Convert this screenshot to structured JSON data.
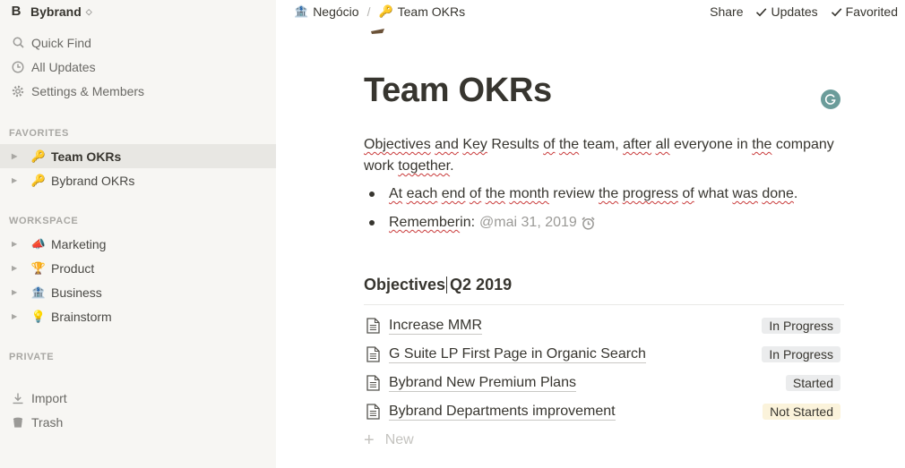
{
  "sidebar": {
    "workspace": "Bybrand",
    "nav": [
      {
        "label": "Quick Find",
        "icon": "search-icon"
      },
      {
        "label": "All Updates",
        "icon": "clock-icon"
      },
      {
        "label": "Settings & Members",
        "icon": "gear-icon"
      }
    ],
    "favorites_header": "FAVORITES",
    "favorites": [
      {
        "label": "Team OKRs",
        "emoji": "🔑",
        "active": true
      },
      {
        "label": "Bybrand OKRs",
        "emoji": "🔑",
        "active": false
      }
    ],
    "workspace_header": "WORKSPACE",
    "workspace_pages": [
      {
        "label": "Marketing",
        "emoji": "📣"
      },
      {
        "label": "Product",
        "emoji": "🏆"
      },
      {
        "label": "Business",
        "emoji": "🏦"
      },
      {
        "label": "Brainstorm",
        "emoji": "💡"
      }
    ],
    "private_header": "PRIVATE",
    "bottom": [
      {
        "label": "Import",
        "icon": "import-icon"
      },
      {
        "label": "Trash",
        "icon": "trash-icon"
      }
    ]
  },
  "topbar": {
    "breadcrumb": [
      {
        "label": "Negócio",
        "emoji": "🏦"
      },
      {
        "label": "Team OKRs",
        "emoji": "🔑"
      }
    ],
    "separator": "/",
    "share": "Share",
    "updates": "Updates",
    "favorited": "Favorited"
  },
  "page": {
    "title": "Team OKRs",
    "intro_words": [
      "Objectives",
      " ",
      "and",
      " ",
      "Key",
      " Results ",
      "of",
      " ",
      "the",
      " team, ",
      "after",
      " ",
      "all",
      " everyone in ",
      "the",
      " company",
      " work ",
      "together",
      "."
    ],
    "bullet1_parts": [
      "At",
      " ",
      "each",
      " ",
      "end",
      " ",
      "of",
      " ",
      "the",
      " ",
      "month",
      " review ",
      "the",
      " ",
      "progress",
      " ",
      "of",
      " what ",
      "was",
      " ",
      "done",
      "."
    ],
    "bullet2_label": "Remember",
    "bullet2_suffix": " in:",
    "reminder": "@mai 31, 2019",
    "section_title_a": "Objectives",
    "section_title_b": " Q2 2019",
    "objectives": [
      {
        "title": "Increase MMR",
        "status": "In Progress",
        "status_color": "gray"
      },
      {
        "title": "G Suite LP First Page in Organic Search",
        "status": "In Progress",
        "status_color": "gray"
      },
      {
        "title": "Bybrand New Premium Plans",
        "status": "Started",
        "status_color": "gray"
      },
      {
        "title": "Bybrand Departments improvement",
        "status": "Not Started",
        "status_color": "yellow"
      }
    ],
    "new_label": "New"
  }
}
